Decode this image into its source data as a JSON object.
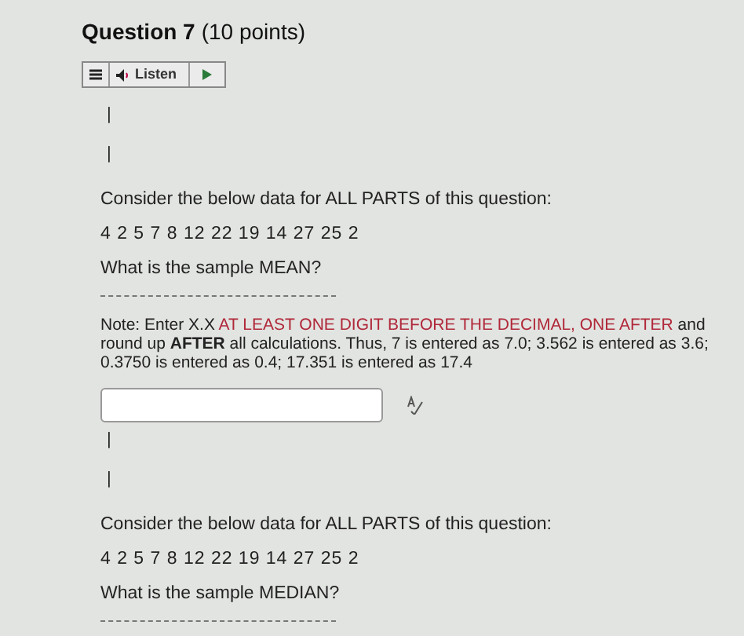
{
  "question": {
    "title": "Question 7",
    "points": "(10 points)"
  },
  "listen_bar": {
    "label": "Listen"
  },
  "parts": [
    {
      "marks": [
        "|",
        "|"
      ],
      "intro": "Consider the below data for ALL PARTS of this question:",
      "data": "4 2 5 7 8 12 22 19 14 27 25 2",
      "prompt": "What is the sample MEAN?",
      "note": [
        {
          "kind": "plain",
          "text": "Note: Enter X.X "
        },
        {
          "kind": "red",
          "text": "AT LEAST ONE DIGIT BEFORE THE DECIMAL, ONE AFTER"
        },
        {
          "kind": "plain",
          "text": " and round up "
        },
        {
          "kind": "bold",
          "text": "AFTER"
        },
        {
          "kind": "plain",
          "text": " all calculations.  Thus, 7 is entered as 7.0; 3.562 is entered as 3.6; 0.3750 is entered as 0.4; 17.351 is entered as 17.4"
        }
      ],
      "answer_field": true
    },
    {
      "marks": [
        "|",
        "|"
      ],
      "intro": "Consider the below data for ALL PARTS of this question:",
      "data": "4 2 5 7 8 12 22 19 14 27 25 2",
      "prompt": "What is the sample MEDIAN?"
    }
  ]
}
